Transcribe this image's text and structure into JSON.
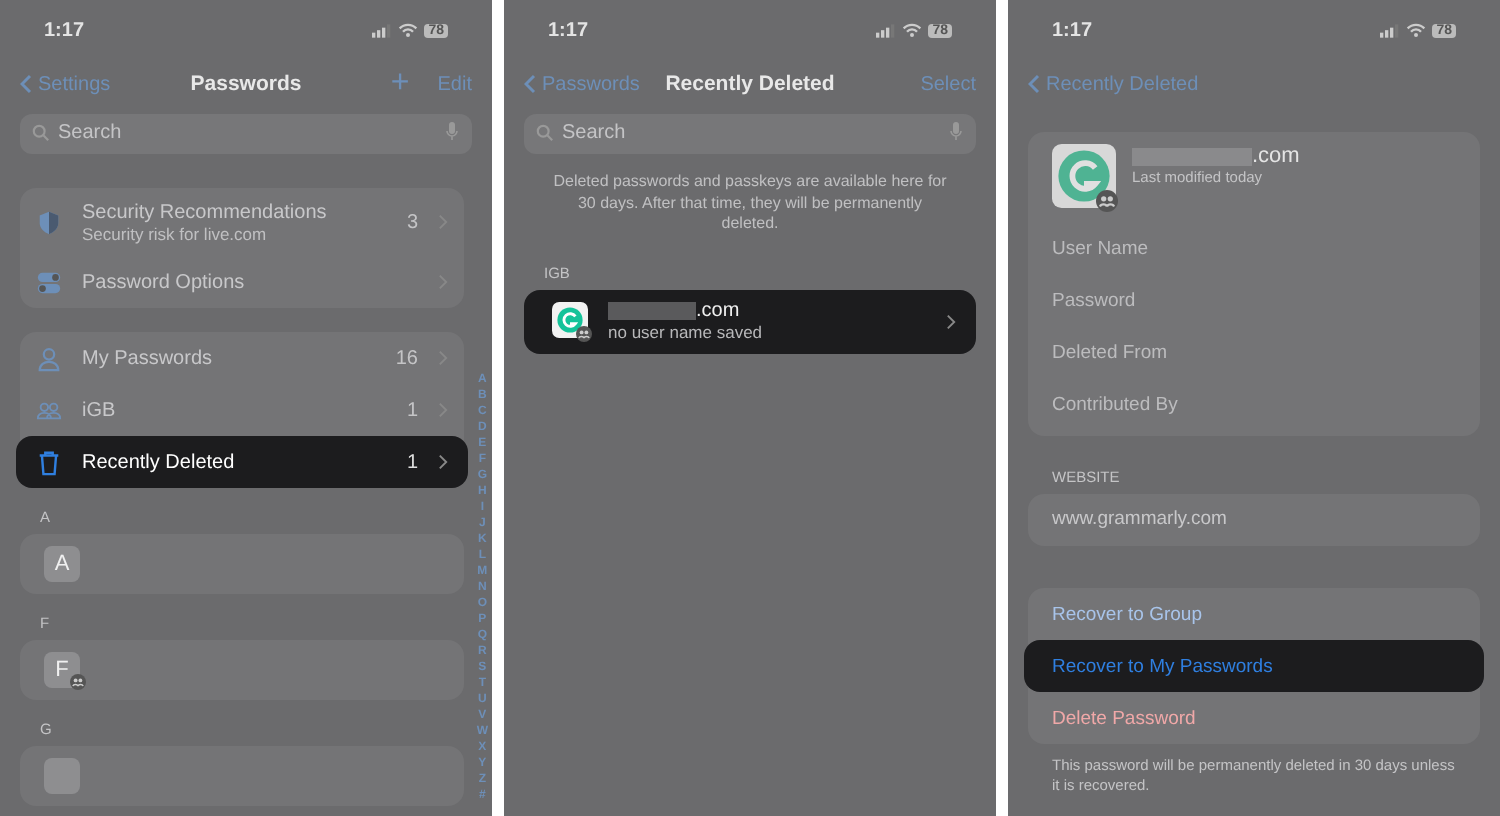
{
  "passwords_screen": {
    "status": {
      "time": "1:17",
      "battery": "78"
    },
    "nav": {
      "back": "Settings",
      "title": "Passwords",
      "add": "+",
      "action": "Edit"
    },
    "search": {
      "placeholder": "Search"
    },
    "groups": [
      {
        "rows": [
          {
            "title": "Security Recommendations",
            "subtitle": "Security risk for live.com",
            "count": "3",
            "highlighted": false
          },
          {
            "title": "Password Options",
            "highlighted": false
          }
        ]
      },
      {
        "rows": [
          {
            "title": "My Passwords",
            "count": "16",
            "highlighted": false
          },
          {
            "title": "iGB",
            "count": "1",
            "highlighted": false
          },
          {
            "title": "Recently Deleted",
            "count": "1",
            "highlighted": true
          }
        ]
      }
    ],
    "sections": [
      {
        "letter": "A",
        "avatar": "A",
        "shared": false
      },
      {
        "letter": "F",
        "avatar": "F",
        "shared": true
      },
      {
        "letter": "G",
        "shared": false
      }
    ],
    "index": [
      "A",
      "B",
      "C",
      "D",
      "E",
      "F",
      "G",
      "H",
      "I",
      "J",
      "K",
      "L",
      "M",
      "N",
      "O",
      "P",
      "Q",
      "R",
      "S",
      "T",
      "U",
      "V",
      "W",
      "X",
      "Y",
      "Z",
      "#"
    ]
  },
  "recently_deleted_screen": {
    "status": {
      "time": "1:17",
      "battery": "78"
    },
    "nav": {
      "back": "Passwords",
      "title": "Recently Deleted",
      "action": "Select"
    },
    "search": {
      "placeholder": "Search"
    },
    "info": "Deleted passwords and passkeys are available here for 30 days. After that time, they will be permanently deleted.",
    "section": "IGB",
    "rows": [
      {
        "domain": ".com",
        "subtitle": "no user name saved",
        "shared": true,
        "highlighted": true
      }
    ]
  },
  "detail_screen": {
    "status": {
      "time": "1:17",
      "battery": "78"
    },
    "nav": {
      "back": "Recently Deleted"
    },
    "header": {
      "domain": ".com",
      "subtitle": "Last modified today",
      "shared": true
    },
    "fields": [
      "User Name",
      "Password",
      "Deleted From",
      "Contributed By"
    ],
    "website_label": "WEBSITE",
    "website": "www.grammarly.com",
    "actions": [
      {
        "label": "Recover to Group",
        "kind": "recover",
        "highlighted": false
      },
      {
        "label": "Recover to My Passwords",
        "kind": "recover",
        "highlighted": true
      },
      {
        "label": "Delete Password",
        "kind": "delete",
        "highlighted": false
      }
    ],
    "footer": "This password will be permanently deleted in 30 days unless it is recovered."
  }
}
